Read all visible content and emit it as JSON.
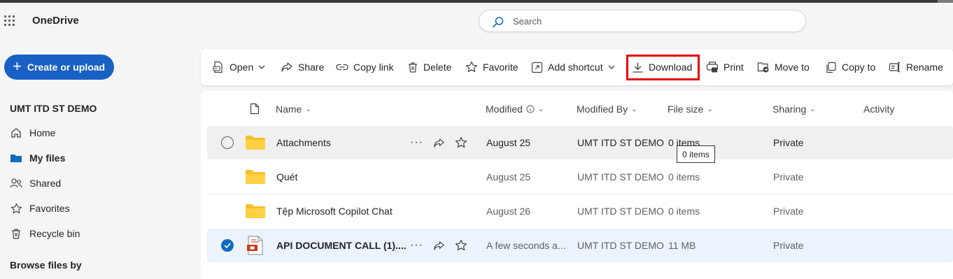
{
  "app": {
    "title": "OneDrive"
  },
  "search": {
    "placeholder": "Search"
  },
  "sidebar": {
    "create_label": "Create or upload",
    "account": "UMT ITD ST DEMO",
    "items": [
      {
        "label": "Home",
        "icon": "home-icon"
      },
      {
        "label": "My files",
        "icon": "folder-icon",
        "active": true
      },
      {
        "label": "Shared",
        "icon": "people-icon"
      },
      {
        "label": "Favorites",
        "icon": "star-icon"
      },
      {
        "label": "Recycle bin",
        "icon": "trash-icon"
      }
    ],
    "browse_label": "Browse files by"
  },
  "toolbar": {
    "open": "Open",
    "share": "Share",
    "copy_link": "Copy link",
    "delete": "Delete",
    "favorite": "Favorite",
    "add_shortcut": "Add shortcut",
    "download": "Download",
    "print": "Print",
    "move_to": "Move to",
    "copy_to": "Copy to",
    "rename": "Rename"
  },
  "columns": {
    "name": "Name",
    "modified": "Modified",
    "modified_by": "Modified By",
    "file_size": "File size",
    "sharing": "Sharing",
    "activity": "Activity"
  },
  "rows": [
    {
      "name": "Attachments",
      "modified": "August 25",
      "modified_by": "UMT ITD ST DEMO",
      "size": "0 items",
      "sharing": "Private",
      "type": "folder"
    },
    {
      "name": "Quét",
      "modified": "August 25",
      "modified_by": "UMT ITD ST DEMO",
      "size": "0 items",
      "sharing": "Private",
      "type": "folder"
    },
    {
      "name": "Tệp Microsoft Copilot Chat",
      "modified": "August 26",
      "modified_by": "UMT ITD ST DEMO",
      "size": "0 items",
      "sharing": "Private",
      "type": "folder"
    },
    {
      "name": "API DOCUMENT CALL (1)....",
      "modified": "A few seconds a...",
      "modified_by": "UMT ITD ST DEMO",
      "size": "11 MB",
      "sharing": "Private",
      "type": "file"
    }
  ],
  "tooltip": "0 items",
  "colors": {
    "accent": "#1860c4",
    "highlight": "#e30000",
    "folder": "#f7c02b",
    "selected_row": "#ebf3fc"
  }
}
